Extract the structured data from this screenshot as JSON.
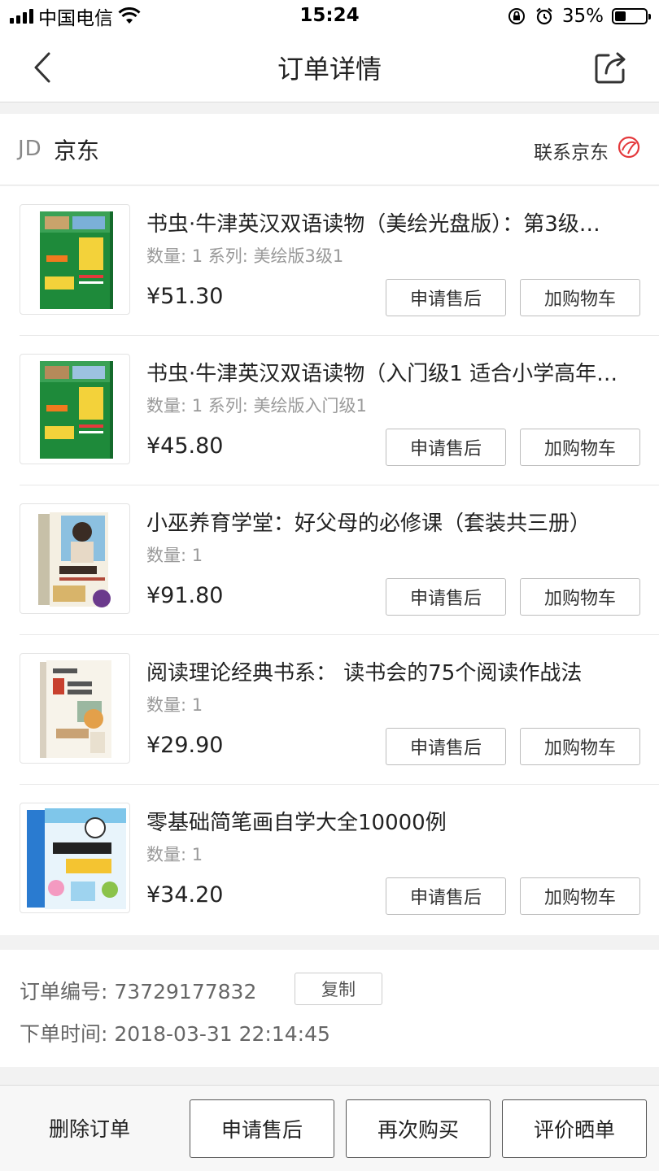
{
  "status_bar": {
    "carrier": "中国电信",
    "time": "15:24",
    "battery_text": "35%",
    "battery_level": 0.35
  },
  "nav": {
    "title": "订单详情"
  },
  "shop": {
    "logo_text": "JD",
    "name": "京东",
    "contact_label": "联系京东"
  },
  "items": [
    {
      "title": "书虫·牛津英汉双语读物（美绘光盘版）：第3级…",
      "meta": "数量: 1 系列: 美绘版3级1",
      "price": "¥51.30",
      "after_sale_label": "申请售后",
      "add_cart_label": "加购物车"
    },
    {
      "title": "书虫·牛津英汉双语读物（入门级1 适合小学高年…",
      "meta": "数量: 1 系列: 美绘版入门级1",
      "price": "¥45.80",
      "after_sale_label": "申请售后",
      "add_cart_label": "加购物车"
    },
    {
      "title": "小巫养育学堂：好父母的必修课（套装共三册）",
      "meta": "数量: 1",
      "price": "¥91.80",
      "after_sale_label": "申请售后",
      "add_cart_label": "加购物车"
    },
    {
      "title": "阅读理论经典书系： 读书会的75个阅读作战法",
      "meta": "数量: 1",
      "price": "¥29.90",
      "after_sale_label": "申请售后",
      "add_cart_label": "加购物车"
    },
    {
      "title": "零基础简笔画自学大全10000例",
      "meta": "数量: 1",
      "price": "¥34.20",
      "after_sale_label": "申请售后",
      "add_cart_label": "加购物车"
    }
  ],
  "order": {
    "number_label": "订单编号:",
    "number": "73729177832",
    "copy_label": "复制",
    "time_label": "下单时间:",
    "time": "2018-03-31 22:14:45"
  },
  "bottom_bar": {
    "delete_label": "删除订单",
    "after_sale_label": "申请售后",
    "rebuy_label": "再次购买",
    "review_label": "评价晒单"
  },
  "colors": {
    "accent_red": "#e4393c",
    "book1_green": "#1e8a3a",
    "book5_blue": "#2a7bd0"
  }
}
